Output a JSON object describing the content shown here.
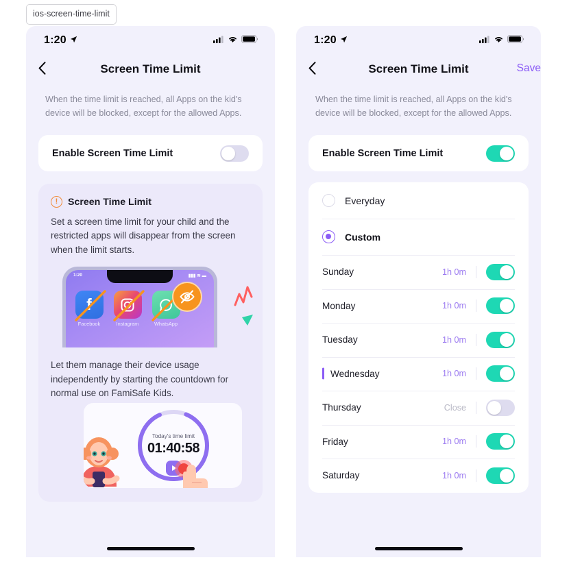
{
  "tag": {
    "label": "ios-screen-time-limit"
  },
  "status_bar": {
    "time": "1:20",
    "location_icon": "location-arrow-icon",
    "cellular_icon": "cellular-signal-icon",
    "wifi_icon": "wifi-icon",
    "battery_icon": "battery-full-icon"
  },
  "nav": {
    "back_icon": "chevron-left-icon",
    "title": "Screen Time Limit",
    "save_label": "Save"
  },
  "intro_text": "When the time limit is reached, all Apps on the kid's device will be blocked, except for the allowed Apps.",
  "left_panel": {
    "enable_row": {
      "label": "Enable Screen Time Limit",
      "state": "off"
    },
    "info_card": {
      "icon": "exclamation-circle-icon",
      "title": "Screen Time Limit",
      "body": "Set a screen time limit for your child and the restricted apps will disappear from the screen when the limit starts.",
      "phone_mock": {
        "status_time": "1:20",
        "apps": [
          {
            "name": "Facebook",
            "glyph": "f",
            "blocked": true
          },
          {
            "name": "Instagram",
            "glyph": "camera",
            "blocked": true
          },
          {
            "name": "WhatsApp",
            "glyph": "chat",
            "blocked": true
          }
        ],
        "badge_icon": "eye-off-icon"
      },
      "body2": "Let them manage their device usage independently by starting the countdown for normal use on FamiSafe Kids.",
      "countdown_card": {
        "ring_label": "Today's time limit",
        "time": "01:40:58",
        "play_icon": "play-button-icon",
        "character_icon": "girl-with-phone-illustration",
        "hand_icon": "tapping-hand-icon"
      }
    }
  },
  "right_panel": {
    "enable_row": {
      "label": "Enable Screen Time Limit",
      "state": "on"
    },
    "schedule_options": [
      {
        "label": "Everyday",
        "selected": false
      },
      {
        "label": "Custom",
        "selected": true
      }
    ],
    "days": [
      {
        "name": "Sunday",
        "value": "1h 0m",
        "state": "on",
        "current": false
      },
      {
        "name": "Monday",
        "value": "1h 0m",
        "state": "on",
        "current": false
      },
      {
        "name": "Tuesday",
        "value": "1h 0m",
        "state": "on",
        "current": false
      },
      {
        "name": "Wednesday",
        "value": "1h 0m",
        "state": "on",
        "current": true
      },
      {
        "name": "Thursday",
        "value": "Close",
        "state": "off",
        "current": false
      },
      {
        "name": "Friday",
        "value": "1h 0m",
        "state": "on",
        "current": false
      },
      {
        "name": "Saturday",
        "value": "1h 0m",
        "state": "on",
        "current": false
      }
    ]
  },
  "colors": {
    "accent_purple": "#8b5cf6",
    "toggle_on_green": "#1ed8b4",
    "toggle_off_gray": "#dedcef",
    "panel_bg": "#f2f1fc",
    "info_card_bg": "#ece9fa",
    "warning_orange": "#f08c3c"
  }
}
